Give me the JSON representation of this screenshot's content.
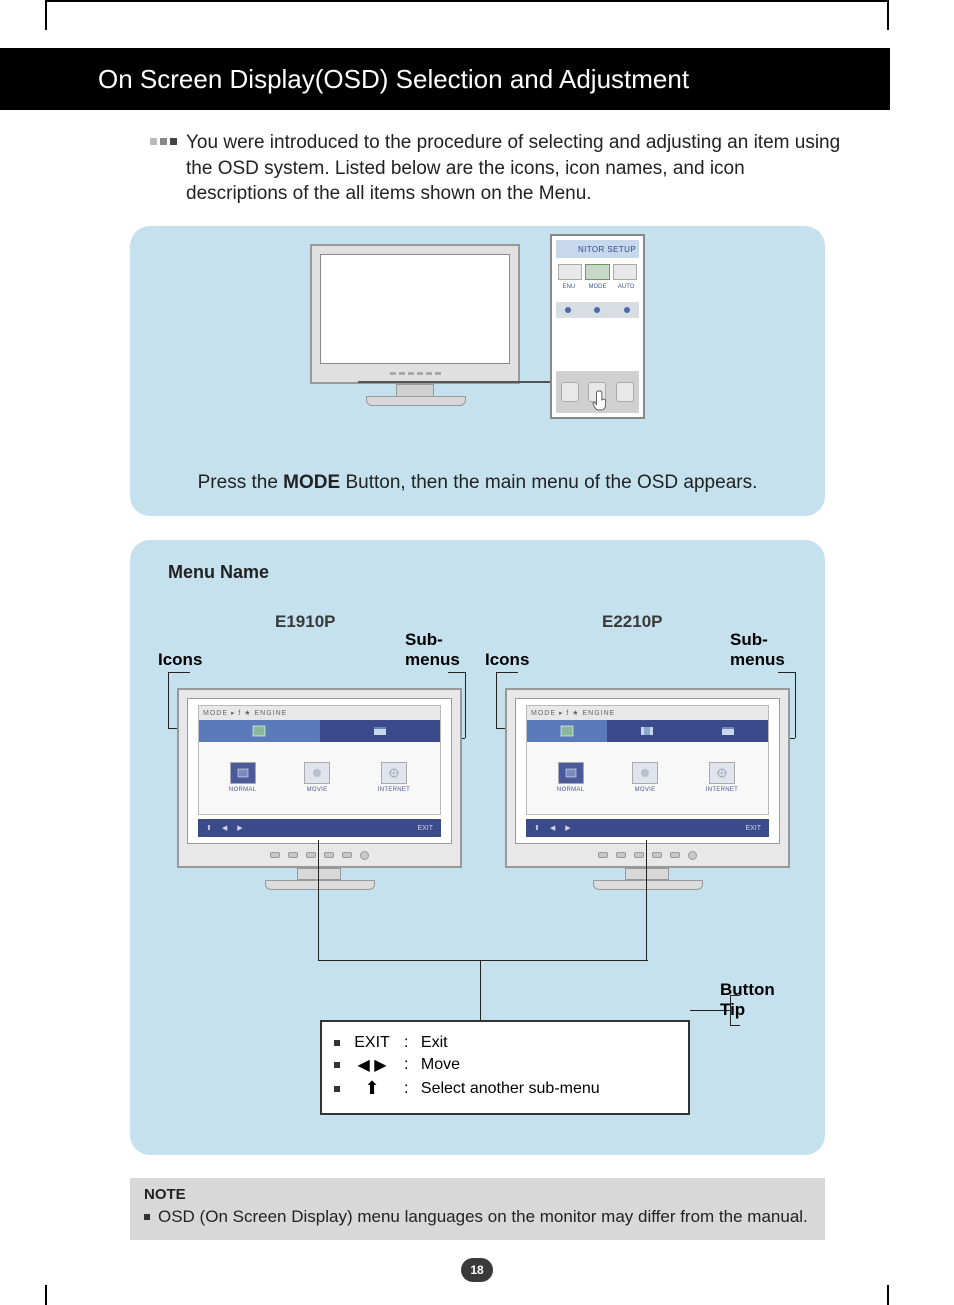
{
  "header": {
    "title": "On Screen Display(OSD) Selection and Adjustment"
  },
  "intro": "You were introduced to the procedure of selecting and adjusting an item using the OSD system. Listed below are the icons, icon names, and icon descriptions of the all items shown on the Menu.",
  "panel1": {
    "zoom_title": "NITOR SETUP",
    "zoom_labels": [
      "ENU",
      "MODE",
      "AUTO"
    ],
    "caption_pre": "Press the ",
    "caption_bold": "MODE",
    "caption_post": " Button, then the main menu of the OSD appears."
  },
  "panel2": {
    "menu_name": "Menu Name",
    "model_a": "E1910P",
    "model_b": "E2210P",
    "icons_label": "Icons",
    "submenus_label_line1": "Sub-",
    "submenus_label_line2": "menus",
    "menu_header": "MODE ▸ f ★ ENGINE",
    "submenu_items": [
      "NORMAL",
      "MOVIE",
      "INTERNET"
    ],
    "btnbar_exit": "EXIT",
    "button_tip_label_line1": "Button",
    "button_tip_label_line2": "Tip",
    "tips": [
      {
        "key": "EXIT",
        "desc": "Exit"
      },
      {
        "key": "◀ ▶",
        "desc": "Move"
      },
      {
        "key": "⬆",
        "desc": "Select another sub-menu"
      }
    ]
  },
  "note": {
    "title": "NOTE",
    "text": "OSD (On Screen Display) menu languages on the monitor may differ from the manual."
  },
  "page_number": "18"
}
